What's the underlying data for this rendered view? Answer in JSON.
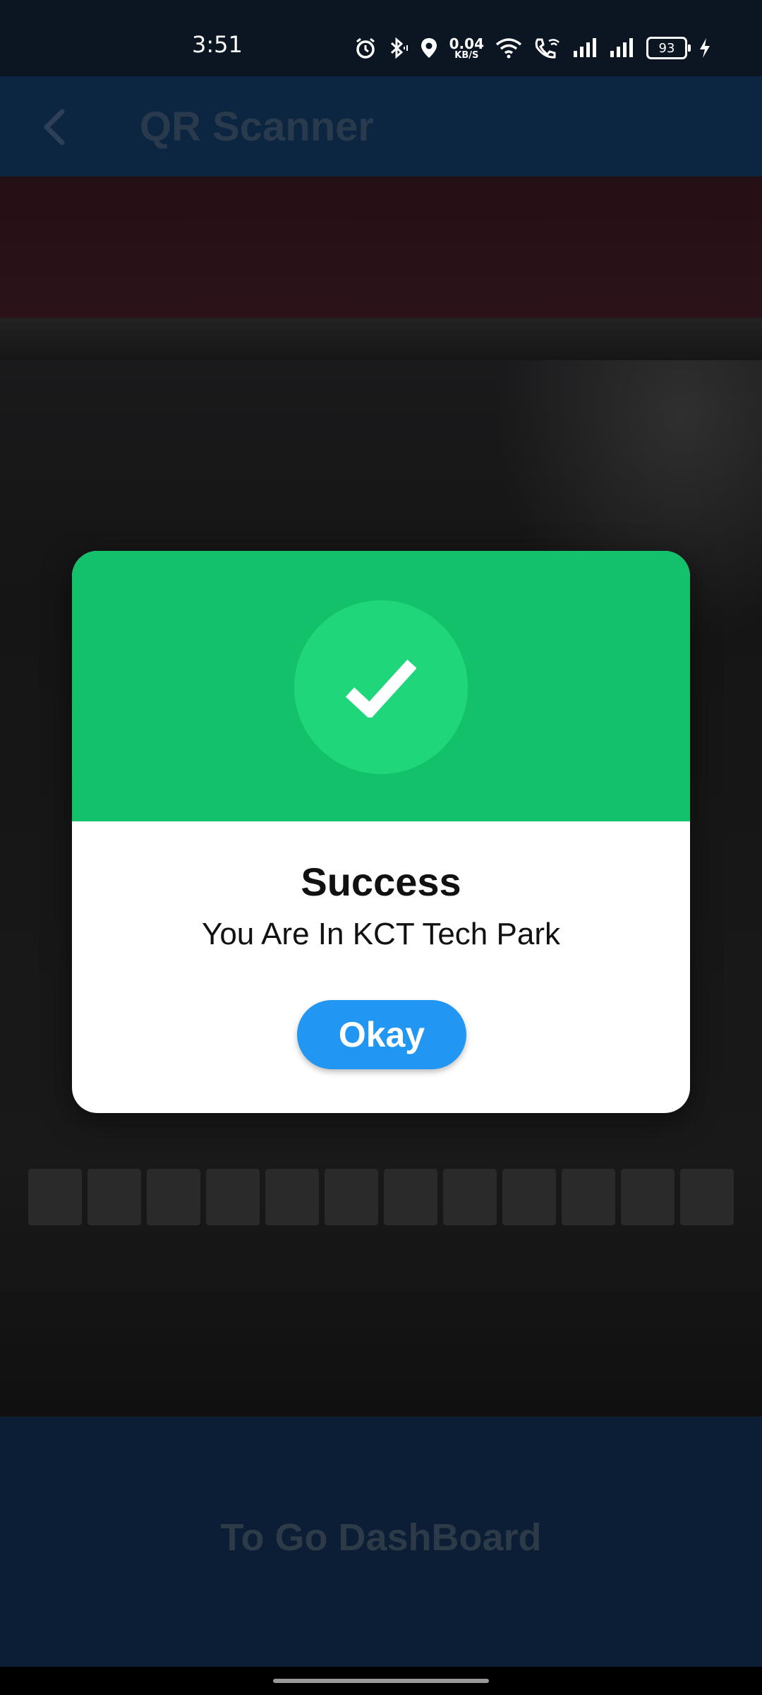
{
  "status_bar": {
    "time": "3:51",
    "net_speed_value": "0.04",
    "net_speed_unit": "KB/S",
    "battery_level": "93",
    "icons": [
      "alarm-icon",
      "bluetooth-icon",
      "location-icon",
      "wifi-icon",
      "wifi-calling-icon",
      "signal-icon",
      "signal-icon",
      "battery-icon",
      "charging-icon"
    ]
  },
  "app_bar": {
    "back_icon": "chevron-left-icon",
    "title": "QR Scanner"
  },
  "dialog": {
    "icon": "checkmark-icon",
    "title": "Success",
    "message": "You Are In KCT Tech Park",
    "button_label": "Okay",
    "header_color": "#13c16b",
    "button_color": "#2196f3"
  },
  "bottom_panel": {
    "label": "To Go DashBoard"
  }
}
